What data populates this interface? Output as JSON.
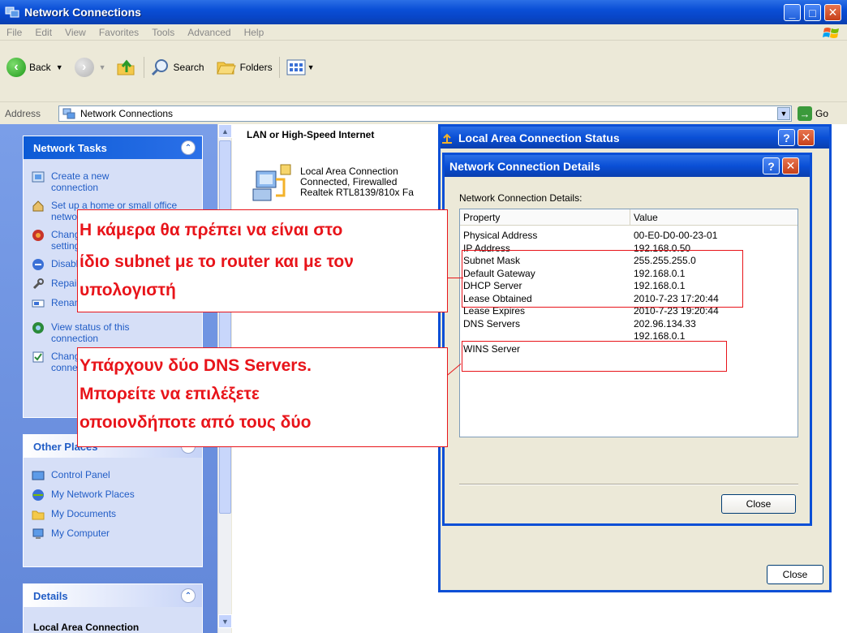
{
  "window": {
    "title": "Network Connections"
  },
  "menu": [
    "File",
    "Edit",
    "View",
    "Favorites",
    "Tools",
    "Advanced",
    "Help"
  ],
  "toolbar": {
    "back_label": "Back",
    "search_label": "Search",
    "folders_label": "Folders"
  },
  "address": {
    "label": "Address",
    "value": "Network Connections",
    "go_label": "Go"
  },
  "network_tasks": {
    "title": "Network Tasks",
    "items": [
      "Create a new connection",
      "Set up a home or small office network",
      "Change Windows Firewall settings",
      "Disable this network device",
      "Repair this connection",
      "Rename this connection",
      "View status of this connection",
      "Change settings of this connection"
    ]
  },
  "other_places": {
    "title": "Other Places",
    "items": [
      "Control Panel",
      "My Network Places",
      "My Documents",
      "My Computer"
    ]
  },
  "details_panel": {
    "title": "Details",
    "subtitle": "Local Area Connection"
  },
  "content": {
    "group_header": "LAN or High-Speed Internet",
    "connection": {
      "name": "Local Area Connection",
      "status": "Connected, Firewalled",
      "adapter": "Realtek RTL8139/810x Fa"
    }
  },
  "status_dialog": {
    "title": "Local Area Connection Status",
    "close_label": "Close"
  },
  "details_dialog": {
    "title": "Network Connection Details",
    "label": "Network Connection Details:",
    "columns": [
      "Property",
      "Value"
    ],
    "rows": [
      {
        "property": "Physical Address",
        "value": "00-E0-D0-00-23-01"
      },
      {
        "property": "IP Address",
        "value": "192.168.0.50"
      },
      {
        "property": "Subnet Mask",
        "value": "255.255.255.0"
      },
      {
        "property": "Default Gateway",
        "value": "192.168.0.1"
      },
      {
        "property": "DHCP Server",
        "value": "192.168.0.1"
      },
      {
        "property": "Lease Obtained",
        "value": "2010-7-23 17:20:44"
      },
      {
        "property": "Lease Expires",
        "value": "2010-7-23 19:20:44"
      },
      {
        "property": "DNS Servers",
        "value": "202.96.134.33"
      },
      {
        "property": "",
        "value": "192.168.0.1"
      },
      {
        "property": "WINS Server",
        "value": ""
      }
    ],
    "close_label": "Close"
  },
  "annotations": {
    "subnet_note": [
      "Η κάμερα θα πρέπει να είναι στο",
      "ίδιο subnet με το router και με τον",
      "υπολογιστή"
    ],
    "dns_note": [
      "Υπάρχουν δύο DNS Servers.",
      "Μπορείτε να επιλέξετε",
      "οποιονδήποτε από τους δύο"
    ],
    "highlight_color": "#e8141a"
  }
}
